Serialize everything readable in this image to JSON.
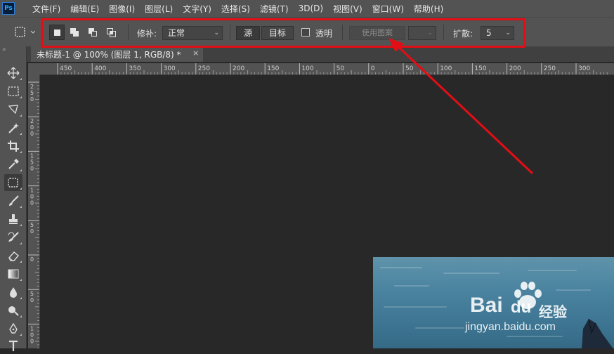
{
  "app": {
    "logo": "Ps"
  },
  "menu": [
    "文件(F)",
    "编辑(E)",
    "图像(I)",
    "图层(L)",
    "文字(Y)",
    "选择(S)",
    "滤镜(T)",
    "3D(D)",
    "视图(V)",
    "窗口(W)",
    "帮助(H)"
  ],
  "options": {
    "patch_label": "修补:",
    "patch_value": "正常",
    "source_label": "源",
    "target_label": "目标",
    "transparent_label": "透明",
    "use_pattern_label": "使用图案",
    "diffusion_label": "扩散:",
    "diffusion_value": "5"
  },
  "document": {
    "tab_title": "未标题-1 @ 100% (图层 1, RGB/8) *",
    "close": "×"
  },
  "ruler": {
    "h_labels": [
      "450",
      "400",
      "350",
      "300",
      "250",
      "200",
      "150",
      "100",
      "50",
      "0",
      "50",
      "100",
      "150",
      "200",
      "250",
      "300"
    ],
    "v_labels": [
      "2\n5\n0",
      "2\n0\n0",
      "1\n5\n0",
      "1\n0\n0",
      "5\n0",
      "0",
      "5\n0",
      "1\n0\n0"
    ]
  },
  "watermark": {
    "brand": "Bai",
    "brand2": "du",
    "product": "经验",
    "url": "jingyan.baidu.com"
  },
  "colors": {
    "highlight": "#e30e15",
    "arrow": "#e30e15"
  },
  "tools": [
    "move-icon",
    "marquee-icon",
    "lasso-icon",
    "magic-wand-icon",
    "crop-icon",
    "eyedropper-icon",
    "patch-icon",
    "brush-icon",
    "stamp-icon",
    "history-brush-icon",
    "eraser-icon",
    "gradient-icon",
    "blur-icon",
    "dodge-icon",
    "pen-icon",
    "type-icon"
  ]
}
